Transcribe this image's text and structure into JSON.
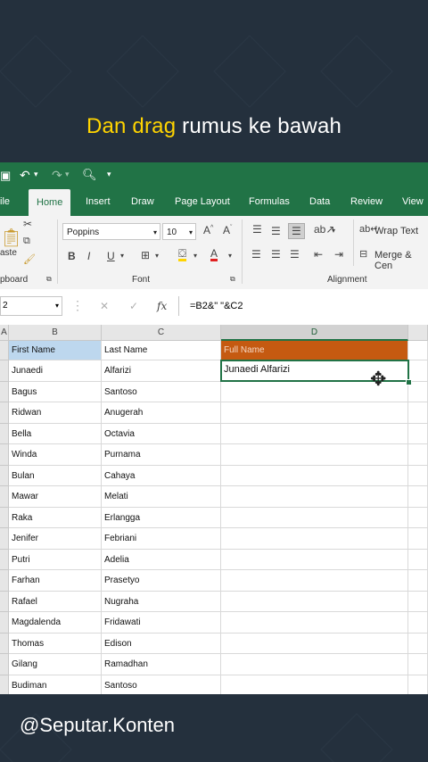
{
  "caption": {
    "part1": "Dan drag",
    "part2": " rumus ke bawah"
  },
  "watermark": "@Seputar.Konten",
  "tabs": [
    {
      "label": "ile"
    },
    {
      "label": "Home",
      "active": true
    },
    {
      "label": "Insert"
    },
    {
      "label": "Draw"
    },
    {
      "label": "Page Layout"
    },
    {
      "label": "Formulas"
    },
    {
      "label": "Data"
    },
    {
      "label": "Review"
    },
    {
      "label": "View"
    }
  ],
  "ribbon": {
    "paste_label": "aste",
    "clipboard_label": "pboard",
    "font_name": "Poppins",
    "font_size": "10",
    "font_group_label": "Font",
    "wrap_text": "Wrap Text",
    "merge_center": "Merge & Cen",
    "alignment_group_label": "Alignment",
    "bold": "B",
    "italic": "I",
    "underline": "U"
  },
  "formula_bar": {
    "name_box": "2",
    "fx": "fx",
    "formula": "=B2&\" \"&C2"
  },
  "columns": [
    "A",
    "B",
    "C",
    "D"
  ],
  "headers": {
    "first": "First Name",
    "last": "Last Name",
    "full": "Full Name"
  },
  "rows": [
    {
      "first": "Junaedi",
      "last": "Alfarizi",
      "full": "Junaedi Alfarizi"
    },
    {
      "first": "Bagus",
      "last": "Santoso",
      "full": ""
    },
    {
      "first": "Ridwan",
      "last": "Anugerah",
      "full": ""
    },
    {
      "first": "Bella",
      "last": "Octavia",
      "full": ""
    },
    {
      "first": "Winda",
      "last": "Purnama",
      "full": ""
    },
    {
      "first": "Bulan",
      "last": "Cahaya",
      "full": ""
    },
    {
      "first": "Mawar",
      "last": "Melati",
      "full": ""
    },
    {
      "first": "Raka",
      "last": "Erlangga",
      "full": ""
    },
    {
      "first": "Jenifer",
      "last": "Febriani",
      "full": ""
    },
    {
      "first": "Putri",
      "last": "Adelia",
      "full": ""
    },
    {
      "first": "Farhan",
      "last": "Prasetyo",
      "full": ""
    },
    {
      "first": "Rafael",
      "last": "Nugraha",
      "full": ""
    },
    {
      "first": "Magdalenda",
      "last": "Fridawati",
      "full": ""
    },
    {
      "first": "Thomas",
      "last": "Edison",
      "full": ""
    },
    {
      "first": "Gilang",
      "last": "Ramadhan",
      "full": ""
    },
    {
      "first": "Budiman",
      "last": "Santoso",
      "full": ""
    }
  ],
  "colors": {
    "excel_green": "#217346",
    "header_orange": "#c55a11",
    "header_blue": "#bdd7ee",
    "caption_yellow": "#ffd400"
  }
}
